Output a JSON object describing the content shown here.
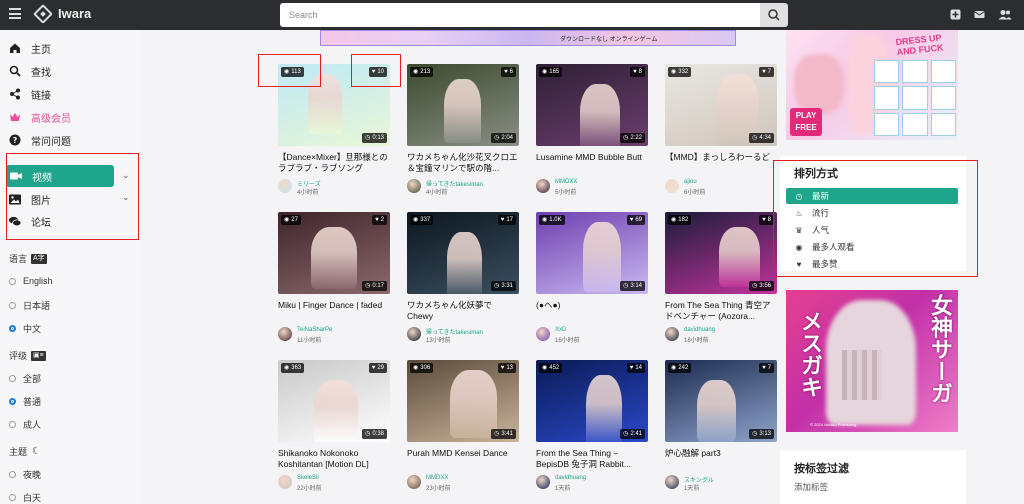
{
  "header": {
    "logo": "Iwara",
    "search_placeholder": "Search"
  },
  "sidebar": {
    "nav": [
      {
        "label": "主页",
        "icon": "home-icon"
      },
      {
        "label": "查找",
        "icon": "search-icon"
      },
      {
        "label": "链接",
        "icon": "share-icon"
      },
      {
        "label": "高级会员",
        "icon": "crown-icon"
      },
      {
        "label": "常问问题",
        "icon": "question-icon"
      }
    ],
    "video": "视频",
    "images": "图片",
    "forum": "论坛",
    "language_title": "语言",
    "languages": [
      "English",
      "日本語",
      "中文"
    ],
    "language_selected": "中文",
    "rating_title": "评级",
    "ratings": [
      "全部",
      "普通",
      "成人"
    ],
    "rating_selected": "普通",
    "theme_title": "主题",
    "themes": [
      "夜晚",
      "白天"
    ]
  },
  "banner_top_text": "ダウンロードなし オンラインゲーム",
  "videos": [
    {
      "views": "113",
      "likes": "10",
      "duration": "0:13",
      "title": "【Dance×Mixer】旦那様とのラブラブ・ラブソング",
      "user": "ミリーズ",
      "time": "4小时前",
      "bg1": "#bfe8f6",
      "bg2": "#e9f7d6"
    },
    {
      "views": "213",
      "likes": "6",
      "duration": "2:04",
      "title": "ワカメちゃん化沙花叉クロエ＆宝鐘マリンで駅の階...",
      "user": "帰ってきたtakesiman",
      "time": "4小时前",
      "bg1": "#3a4a2e",
      "bg2": "#8a8f85"
    },
    {
      "views": "165",
      "likes": "8",
      "duration": "2:22",
      "title": "Lusamine MMD Bubble Butt",
      "user": "MMDXX",
      "time": "5小时前",
      "bg1": "#2e1f35",
      "bg2": "#6b3f6e"
    },
    {
      "views": "332",
      "likes": "7",
      "duration": "4:34",
      "title": "【MMD】まっしろわーるど",
      "user": "ajiou",
      "time": "6小时前",
      "bg1": "#e9e7e2",
      "bg2": "#cfc6bb"
    },
    {
      "views": "27",
      "likes": "2",
      "duration": "0:17",
      "title": "Miku | Finger Dance | faded",
      "user": "TeiNaSharPe",
      "time": "11小时前",
      "bg1": "#3d2428",
      "bg2": "#8c6a6f"
    },
    {
      "views": "337",
      "likes": "17",
      "duration": "3:31",
      "title": "ワカメちゃん化妖夢で Chewy",
      "user": "帰ってきたtakesiman",
      "time": "13小时前",
      "bg1": "#0c1620",
      "bg2": "#3b4f5f"
    },
    {
      "views": "1.0K",
      "likes": "69",
      "duration": "3:14",
      "title": "(●ヘ●)",
      "user": "XxD",
      "time": "16小时前",
      "bg1": "#6e3fb0",
      "bg2": "#c9b9f0"
    },
    {
      "views": "182",
      "likes": "8",
      "duration": "3:56",
      "title": "From The Sea Thing 青空アドベンチャー (Aozora...",
      "user": "davidhuang",
      "time": "18小时前",
      "bg1": "#1a1d3a",
      "bg2": "#c2339c"
    },
    {
      "views": "363",
      "likes": "29",
      "duration": "0:38",
      "title": "Shikanoko Nokonoko Koshitantan [Motion DL]",
      "user": "SkeleSli",
      "time": "22小时前",
      "bg1": "#c8c8c8",
      "bg2": "#ffffff"
    },
    {
      "views": "306",
      "likes": "13",
      "duration": "3:41",
      "title": "Purah MMD Kensei Dance",
      "user": "MMDXX",
      "time": "23小时前",
      "bg1": "#5a4a3a",
      "bg2": "#c9b59c"
    },
    {
      "views": "452",
      "likes": "14",
      "duration": "2:41",
      "title": "From the Sea Thing – BepisDB 兔子洞 Rabbit...",
      "user": "davidhuang",
      "time": "1天前",
      "bg1": "#0a1a55",
      "bg2": "#2a49c9"
    },
    {
      "views": "242",
      "likes": "7",
      "duration": "3:13",
      "title": "炉心融解 part3",
      "user": "スキングル",
      "time": "1天前",
      "bg1": "#1c2a4f",
      "bg2": "#8fa4c9"
    }
  ],
  "sort": {
    "title": "排列方式",
    "items": [
      {
        "label": "最新",
        "icon": "clock-icon"
      },
      {
        "label": "流行",
        "icon": "fire-icon"
      },
      {
        "label": "人气",
        "icon": "crown-icon"
      },
      {
        "label": "最多人观看",
        "icon": "eye-icon"
      },
      {
        "label": "最多赞",
        "icon": "heart-icon"
      }
    ],
    "active": "最新"
  },
  "ad_top": {
    "text1": "PLAY",
    "text2": "FREE",
    "text3": "DRESS UP AND FUCK"
  },
  "ad_mid": {
    "text1": "女神サーガ",
    "text2": "メスガキ",
    "text3": "© 2024 Nutaku Publishing"
  },
  "tag_filter": {
    "title": "按标签过滤",
    "add": "添加标签"
  },
  "colors": {
    "accent": "#1fa58b",
    "header": "#2b2d31",
    "premium": "#e64e9b",
    "annotation": "#e02020"
  }
}
